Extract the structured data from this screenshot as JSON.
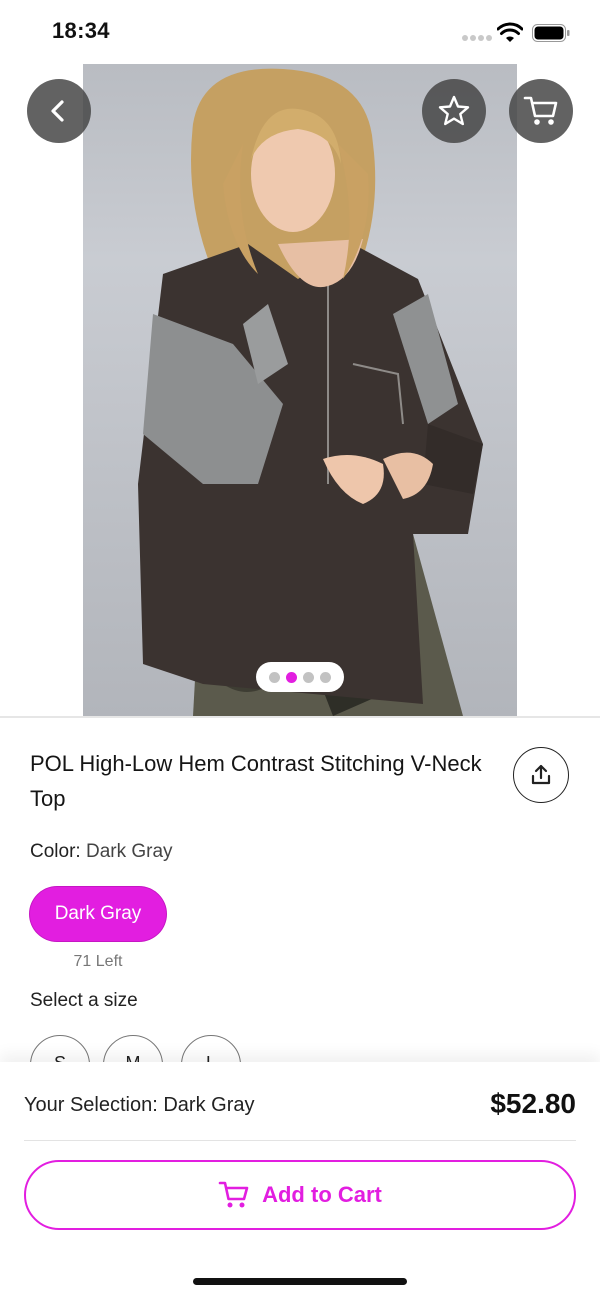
{
  "status_bar": {
    "time": "18:34"
  },
  "product": {
    "title": "POL High-Low Hem Contrast Stitching V-Neck Top",
    "color_label": "Color:",
    "color_value": "Dark Gray",
    "color_options": [
      {
        "label": "Dark Gray",
        "selected": true
      }
    ],
    "stock_text": "71 Left",
    "size_label": "Select a size",
    "sizes": [
      "S",
      "M",
      "L"
    ],
    "image_pager": {
      "count": 4,
      "active_index": 1
    }
  },
  "footer": {
    "selection_text": "Your Selection: Dark Gray",
    "price": "$52.80",
    "add_to_cart_label": "Add to Cart"
  },
  "icons": {
    "back": "back-chevron-icon",
    "favorite": "star-icon",
    "cart": "cart-icon",
    "share": "share-icon"
  },
  "colors": {
    "accent": "#e21ee0",
    "control_bg": "#464646"
  }
}
